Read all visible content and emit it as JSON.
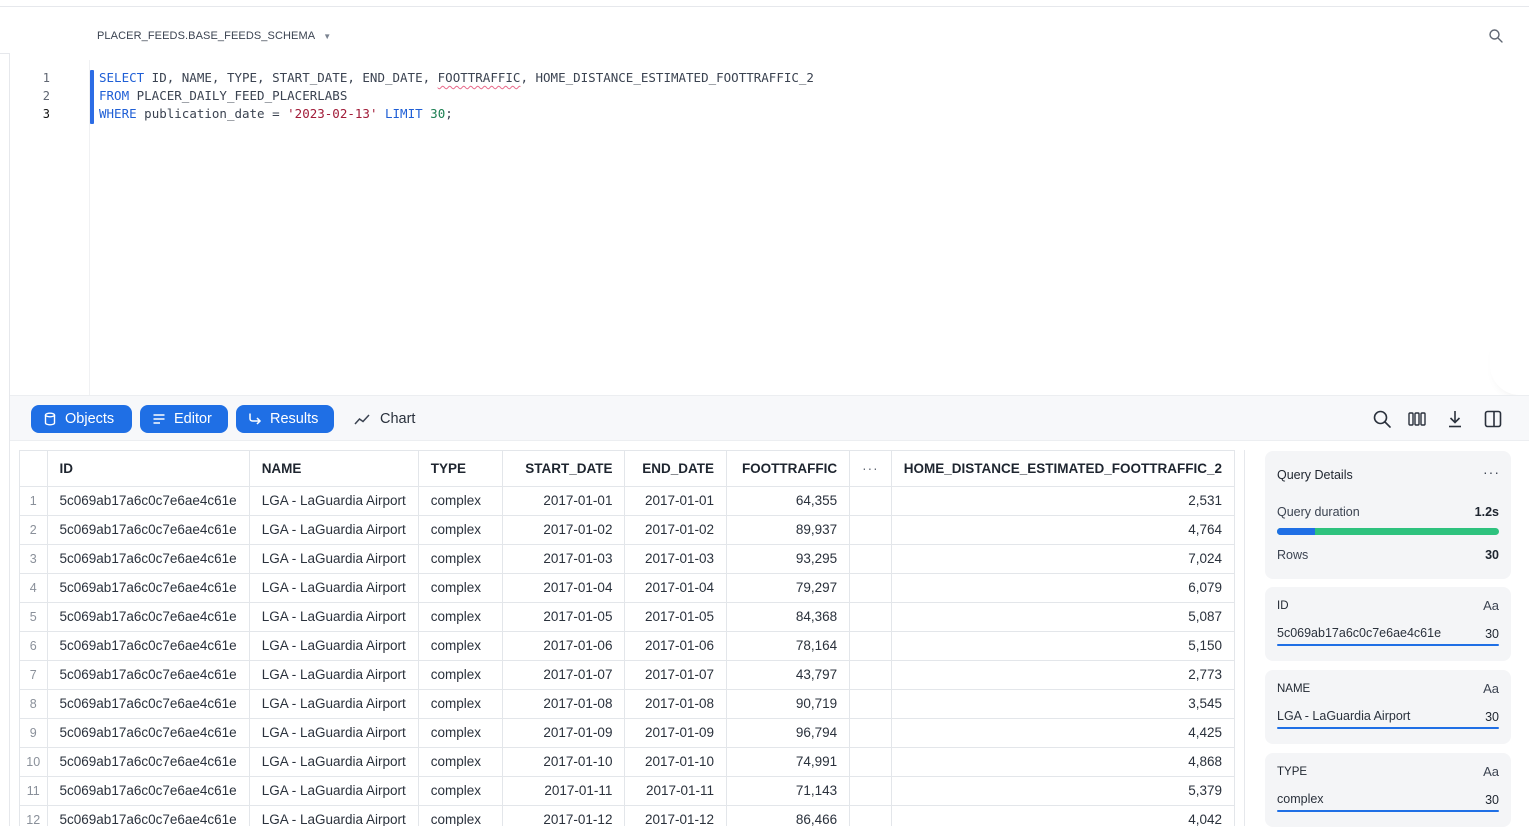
{
  "header": {
    "schema": "PLACER_FEEDS.BASE_FEEDS_SCHEMA"
  },
  "editor": {
    "lines": [
      {
        "num": "1",
        "tokens": [
          {
            "t": "SELECT",
            "c": "kw"
          },
          {
            "t": " ID, NAME, TYPE, START_DATE, END_DATE, ",
            "c": ""
          },
          {
            "t": "FOOTTRAFFIC",
            "c": "squiggle"
          },
          {
            "t": ", HOME_DISTANCE_ESTIMATED_FOOTTRAFFIC_2",
            "c": ""
          }
        ]
      },
      {
        "num": "2",
        "tokens": [
          {
            "t": "FROM",
            "c": "kw"
          },
          {
            "t": " PLACER_DAILY_FEED_PLACERLABS",
            "c": ""
          }
        ]
      },
      {
        "num": "3",
        "tokens": [
          {
            "t": "WHERE",
            "c": "kw"
          },
          {
            "t": " publication_date = ",
            "c": ""
          },
          {
            "t": "'2023-02-13'",
            "c": "str"
          },
          {
            "t": " ",
            "c": ""
          },
          {
            "t": "LIMIT",
            "c": "kw"
          },
          {
            "t": " ",
            "c": ""
          },
          {
            "t": "30",
            "c": "num"
          },
          {
            "t": ";",
            "c": ""
          }
        ]
      }
    ]
  },
  "toolbar": {
    "objects_label": "Objects",
    "editor_label": "Editor",
    "results_label": "Results",
    "chart_label": "Chart"
  },
  "results": {
    "columns": [
      "ID",
      "NAME",
      "TYPE",
      "START_DATE",
      "END_DATE",
      "FOOTTRAFFIC",
      "···",
      "HOME_DISTANCE_ESTIMATED_FOOTTRAFFIC_2"
    ],
    "rows": [
      [
        "1",
        "5c069ab17a6c0c7e6ae4c61e",
        "LGA - LaGuardia Airport",
        "complex",
        "2017-01-01",
        "2017-01-01",
        "64,355",
        "2,531"
      ],
      [
        "2",
        "5c069ab17a6c0c7e6ae4c61e",
        "LGA - LaGuardia Airport",
        "complex",
        "2017-01-02",
        "2017-01-02",
        "89,937",
        "4,764"
      ],
      [
        "3",
        "5c069ab17a6c0c7e6ae4c61e",
        "LGA - LaGuardia Airport",
        "complex",
        "2017-01-03",
        "2017-01-03",
        "93,295",
        "7,024"
      ],
      [
        "4",
        "5c069ab17a6c0c7e6ae4c61e",
        "LGA - LaGuardia Airport",
        "complex",
        "2017-01-04",
        "2017-01-04",
        "79,297",
        "6,079"
      ],
      [
        "5",
        "5c069ab17a6c0c7e6ae4c61e",
        "LGA - LaGuardia Airport",
        "complex",
        "2017-01-05",
        "2017-01-05",
        "84,368",
        "5,087"
      ],
      [
        "6",
        "5c069ab17a6c0c7e6ae4c61e",
        "LGA - LaGuardia Airport",
        "complex",
        "2017-01-06",
        "2017-01-06",
        "78,164",
        "5,150"
      ],
      [
        "7",
        "5c069ab17a6c0c7e6ae4c61e",
        "LGA - LaGuardia Airport",
        "complex",
        "2017-01-07",
        "2017-01-07",
        "43,797",
        "2,773"
      ],
      [
        "8",
        "5c069ab17a6c0c7e6ae4c61e",
        "LGA - LaGuardia Airport",
        "complex",
        "2017-01-08",
        "2017-01-08",
        "90,719",
        "3,545"
      ],
      [
        "9",
        "5c069ab17a6c0c7e6ae4c61e",
        "LGA - LaGuardia Airport",
        "complex",
        "2017-01-09",
        "2017-01-09",
        "96,794",
        "4,425"
      ],
      [
        "10",
        "5c069ab17a6c0c7e6ae4c61e",
        "LGA - LaGuardia Airport",
        "complex",
        "2017-01-10",
        "2017-01-10",
        "74,991",
        "4,868"
      ],
      [
        "11",
        "5c069ab17a6c0c7e6ae4c61e",
        "LGA - LaGuardia Airport",
        "complex",
        "2017-01-11",
        "2017-01-11",
        "71,143",
        "5,379"
      ],
      [
        "12",
        "5c069ab17a6c0c7e6ae4c61e",
        "LGA - LaGuardia Airport",
        "complex",
        "2017-01-12",
        "2017-01-12",
        "86,466",
        "4,042"
      ]
    ]
  },
  "query_details": {
    "title": "Query Details",
    "more": "···",
    "duration_label": "Query duration",
    "duration_value": "1.2s",
    "duration_bar_fraction": 0.17,
    "rows_label": "Rows",
    "rows_value": "30"
  },
  "column_cards": [
    {
      "name": "ID",
      "type": "Aa",
      "value": "5c069ab17a6c0c7e6ae4c61e",
      "count": "30"
    },
    {
      "name": "NAME",
      "type": "Aa",
      "value": "LGA - LaGuardia Airport",
      "count": "30"
    },
    {
      "name": "TYPE",
      "type": "Aa",
      "value": "complex",
      "count": "30"
    }
  ],
  "icons": {
    "top_search": "search-icon",
    "objects": "database-icon",
    "editor": "lines-icon",
    "results": "arrow-return-icon",
    "chart": "line-chart-icon",
    "toolbar": [
      "search-icon",
      "columns-icon",
      "download-icon",
      "split-panel-icon"
    ]
  },
  "colors": {
    "accent": "#1f6fe5",
    "keyword": "#1f5fd6",
    "string": "#a11b38",
    "number": "#1b7f52",
    "bar_green": "#2ec27e"
  }
}
